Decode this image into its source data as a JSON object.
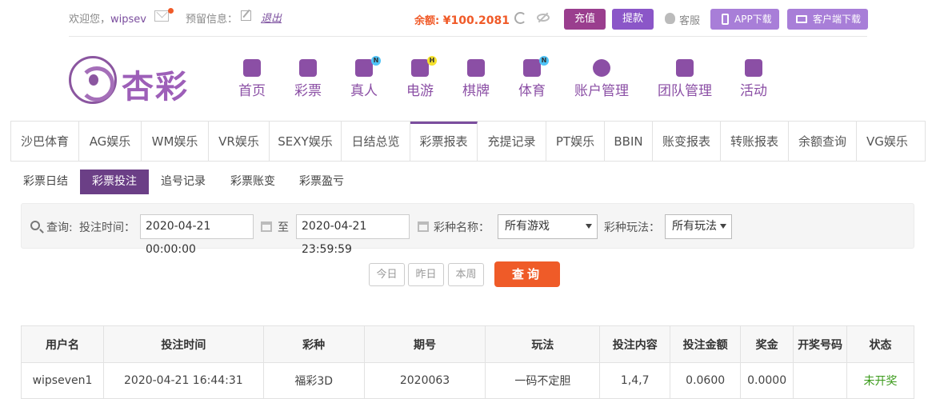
{
  "topbar": {
    "greeting_prefix": "欢迎您，",
    "username": "wipsev",
    "reserve_label": "预留信息：",
    "logout": "退出",
    "balance_label": "余额: ",
    "balance_value": "¥100.2081",
    "recharge": "充值",
    "withdraw": "提款",
    "service": "客服",
    "app_download": "APP下载",
    "client_download": "客户端下载"
  },
  "logo": {
    "brand": "杏彩"
  },
  "mainnav": [
    {
      "label": "首页",
      "icon": "home-icon",
      "badge": ""
    },
    {
      "label": "彩票",
      "icon": "lottery-icon",
      "badge": ""
    },
    {
      "label": "真人",
      "icon": "live-casino-icon",
      "badge": "N"
    },
    {
      "label": "电游",
      "icon": "gamepad-icon",
      "badge": "H"
    },
    {
      "label": "棋牌",
      "icon": "cards-icon",
      "badge": ""
    },
    {
      "label": "体育",
      "icon": "trophy-icon",
      "badge": "N"
    },
    {
      "label": "账户管理",
      "icon": "yen-icon",
      "badge": ""
    },
    {
      "label": "团队管理",
      "icon": "team-icon",
      "badge": ""
    },
    {
      "label": "活动",
      "icon": "gift-icon",
      "badge": ""
    }
  ],
  "tabs": [
    "沙巴体育",
    "AG娱乐",
    "WM娱乐",
    "VR娱乐",
    "SEXY娱乐",
    "日结总览",
    "彩票报表",
    "充提记录",
    "PT娱乐",
    "BBIN",
    "账变报表",
    "转账报表",
    "余额查询",
    "VG娱乐"
  ],
  "active_tab": "彩票报表",
  "subtabs": [
    "彩票日结",
    "彩票投注",
    "追号记录",
    "彩票账变",
    "彩票盈亏"
  ],
  "active_subtab": "彩票投注",
  "query": {
    "query_label": "查询:",
    "time_label": "投注时间：",
    "start_time": "2020-04-21 00:00:00",
    "to_label": "至",
    "end_time": "2020-04-21 23:59:59",
    "game_label": "彩种名称：",
    "game_value": "所有游戏",
    "play_label": "彩种玩法：",
    "play_value": "所有玩法"
  },
  "quick": {
    "today": "今日",
    "yesterday": "昨日",
    "week": "本周",
    "query": "查询"
  },
  "table": {
    "headers": [
      "用户名",
      "投注时间",
      "彩种",
      "期号",
      "玩法",
      "投注内容",
      "投注金额",
      "奖金",
      "开奖号码",
      "状态"
    ],
    "rows": [
      [
        "wipseven1",
        "2020-04-21 16:44:31",
        "福彩3D",
        "2020063",
        "一码不定胆",
        "1,4,7",
        "0.0600",
        "0.0000",
        "",
        "未开奖"
      ]
    ]
  },
  "colors": {
    "brand_purple": "#7b4e9e",
    "accent_orange": "#ef5b28",
    "status_green": "#3a9a1a"
  }
}
